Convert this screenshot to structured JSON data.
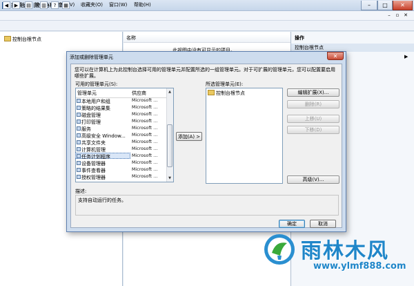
{
  "window": {
    "title": "控制台1 - [控制台根节点]",
    "buttons": {
      "minimize": "–",
      "maximize": "□",
      "close": "✕"
    }
  },
  "menu": {
    "items": [
      "文件(F)",
      "操作(A)",
      "查看(V)",
      "收藏夹(O)",
      "窗口(W)",
      "帮助(H)"
    ],
    "mdi": {
      "minimize": "–",
      "restore": "▫",
      "close": "✕"
    }
  },
  "tree": {
    "root": "控制台根节点"
  },
  "list": {
    "header": "名称",
    "empty_message": "此视图中没有可显示的项目。"
  },
  "actions": {
    "title": "操作",
    "selected": "控制台根节点",
    "more": "▶"
  },
  "dialog": {
    "title": "添加或删除管理单元",
    "close": "✕",
    "description": "您可以在计算机上为此控制台选择可用的管理单元并配置所选的一组管理单元。对于可扩展的管理单元，您可以配置要启用哪些扩展。",
    "available_label": "可用的管理单元(S):",
    "columns": {
      "name": "管理单元",
      "vendor": "供应商"
    },
    "snapins": [
      {
        "name": "本地用户和组",
        "vendor": "Microsoft ..."
      },
      {
        "name": "策略的结果集",
        "vendor": "Microsoft ..."
      },
      {
        "name": "磁盘管理",
        "vendor": "Microsoft ..."
      },
      {
        "name": "打印管理",
        "vendor": "Microsoft ..."
      },
      {
        "name": "服务",
        "vendor": "Microsoft ..."
      },
      {
        "name": "高级安全 Window...",
        "vendor": "Microsoft ..."
      },
      {
        "name": "共享文件夹",
        "vendor": "Microsoft ..."
      },
      {
        "name": "计算机管理",
        "vendor": "Microsoft ..."
      },
      {
        "name": "任务计划程序",
        "vendor": "Microsoft ..."
      },
      {
        "name": "设备管理器",
        "vendor": "Microsoft ..."
      },
      {
        "name": "事件查看器",
        "vendor": "Microsoft ..."
      },
      {
        "name": "授权管理器",
        "vendor": "Microsoft ..."
      }
    ],
    "selected_index": 8,
    "add_button": "添加(A) >",
    "selected_label": "所选管理单元(E):",
    "selected_items": [
      "控制台根节点"
    ],
    "buttons": {
      "edit_ext": "编辑扩展(X)...",
      "remove": "删除(R)",
      "move_up": "上移(U)",
      "move_down": "下移(D)",
      "advanced": "高级(V)..."
    },
    "description_label": "描述:",
    "description_text": "支持自动运行的任务。",
    "ok": "确定",
    "cancel": "取消"
  },
  "watermark": {
    "text": "雨林木风",
    "url": "www.ylmf888.com"
  },
  "colors": {
    "accent": "#1f86c9",
    "selection": "#d9e6f7",
    "dialog_frame": "#cddcee"
  }
}
